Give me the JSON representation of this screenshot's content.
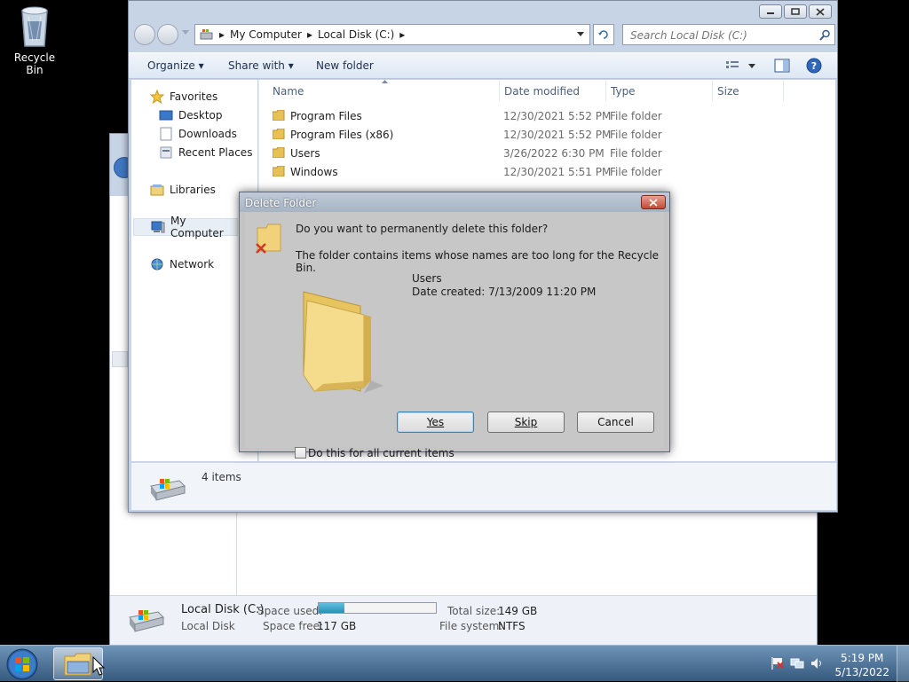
{
  "desktop": {
    "recycle_bin_label": "Recycle Bin"
  },
  "back_window": {
    "drive_name": "Local Disk (C:)",
    "drive_type": "Local Disk",
    "space_used_label": "Space used:",
    "space_used_fraction": 0.22,
    "space_free_label": "Space free:",
    "space_free_value": "117 GB",
    "total_size_label": "Total size:",
    "total_size_value": "149 GB",
    "file_system_label": "File system:",
    "file_system_value": "NTFS"
  },
  "explorer": {
    "breadcrumb": [
      "My Computer",
      "Local Disk (C:)"
    ],
    "search_placeholder": "Search Local Disk (C:)",
    "toolbar": {
      "organize": "Organize",
      "share_with": "Share with",
      "new_folder": "New folder"
    },
    "nav": {
      "favorites": "Favorites",
      "desktop": "Desktop",
      "downloads": "Downloads",
      "recent_places": "Recent Places",
      "libraries": "Libraries",
      "my_computer": "My Computer",
      "network": "Network"
    },
    "columns": {
      "name": "Name",
      "date_modified": "Date modified",
      "type": "Type",
      "size": "Size"
    },
    "rows": [
      {
        "name": "Program Files",
        "date": "12/30/2021 5:52 PM",
        "type": "File folder"
      },
      {
        "name": "Program Files (x86)",
        "date": "12/30/2021 5:52 PM",
        "type": "File folder"
      },
      {
        "name": "Users",
        "date": "3/26/2022 6:30 PM",
        "type": "File folder"
      },
      {
        "name": "Windows",
        "date": "12/30/2021 5:51 PM",
        "type": "File folder"
      }
    ],
    "status": "4 items"
  },
  "dialog": {
    "title": "Delete Folder",
    "question": "Do you want to permanently delete this folder?",
    "message": "The folder contains items whose names are too long for the Recycle Bin.",
    "folder_name": "Users",
    "date_created": "Date created: 7/13/2009 11:20 PM",
    "yes": "Yes",
    "skip": "Skip",
    "cancel": "Cancel",
    "checkbox_label": "Do this for all current items"
  },
  "taskbar": {
    "time": "5:19 PM",
    "date": "5/13/2022"
  }
}
